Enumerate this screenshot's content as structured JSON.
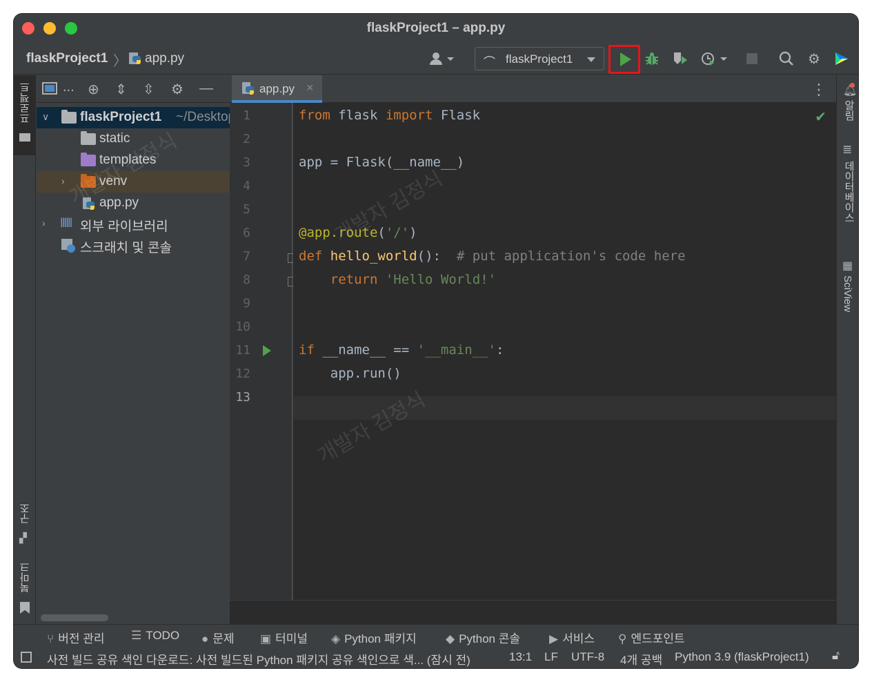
{
  "window": {
    "title": "flaskProject1 – app.py"
  },
  "breadcrumb": {
    "project": "flaskProject1",
    "file": "app.py"
  },
  "toolbar": {
    "run_config": "flaskProject1"
  },
  "left_strip": {
    "project_label": "프로젝트",
    "structure_label": "구조",
    "bookmarks_label": "북마크"
  },
  "right_strip": {
    "notifications_label": "알림",
    "database_label": "데이터베이스",
    "sciview_label": "SciView"
  },
  "project_tree": {
    "root_name": "flaskProject1",
    "root_path": "~/Desktop",
    "items": [
      {
        "label": "static"
      },
      {
        "label": "templates"
      },
      {
        "label": "venv"
      },
      {
        "label": "app.py"
      }
    ],
    "external_libraries": "외부 라이브러리",
    "scratches": "스크래치 및 콘솔"
  },
  "editor": {
    "tab_label": "app.py",
    "line_numbers": [
      "1",
      "2",
      "3",
      "4",
      "5",
      "6",
      "7",
      "8",
      "9",
      "10",
      "11",
      "12",
      "13"
    ],
    "current_line": "13"
  },
  "watermark": "개발자 김정식",
  "tool_windows": [
    "버전 관리",
    "TODO",
    "문제",
    "터미널",
    "Python 패키지",
    "Python 콘솔",
    "서비스",
    "엔드포인트"
  ],
  "status": {
    "message": "사전 빌드 공유 색인 다운로드: 사전 빌드된 Python 패키지 공유 색인으로 색... (잠시 전)",
    "position": "13:1",
    "line_sep": "LF",
    "encoding": "UTF-8",
    "indent": "4개 공백",
    "interpreter": "Python 3.9 (flaskProject1)"
  }
}
